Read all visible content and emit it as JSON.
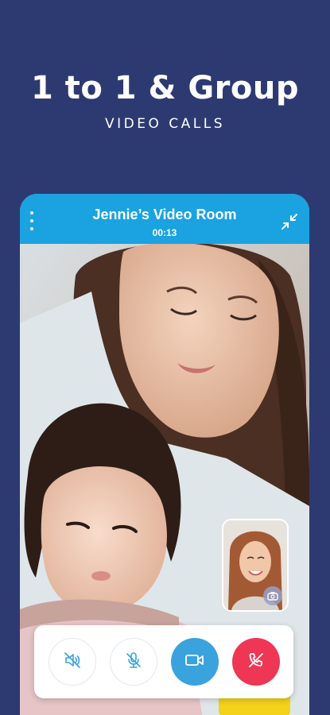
{
  "hero": {
    "headline": "1 to 1 & Group",
    "subhead": "VIDEO CALLS"
  },
  "call": {
    "room_title": "Jennie’s Video Room",
    "timer": "00:13"
  },
  "controls": {
    "speaker_icon": "speaker-muted-icon",
    "mic_icon": "mic-muted-icon",
    "video_icon": "video-camera-icon",
    "end_icon": "end-call-icon"
  },
  "colors": {
    "background": "#2d3a72",
    "call_bar": "#1aa3e0",
    "video_button": "#3aa3dd",
    "end_button": "#ef3655"
  }
}
